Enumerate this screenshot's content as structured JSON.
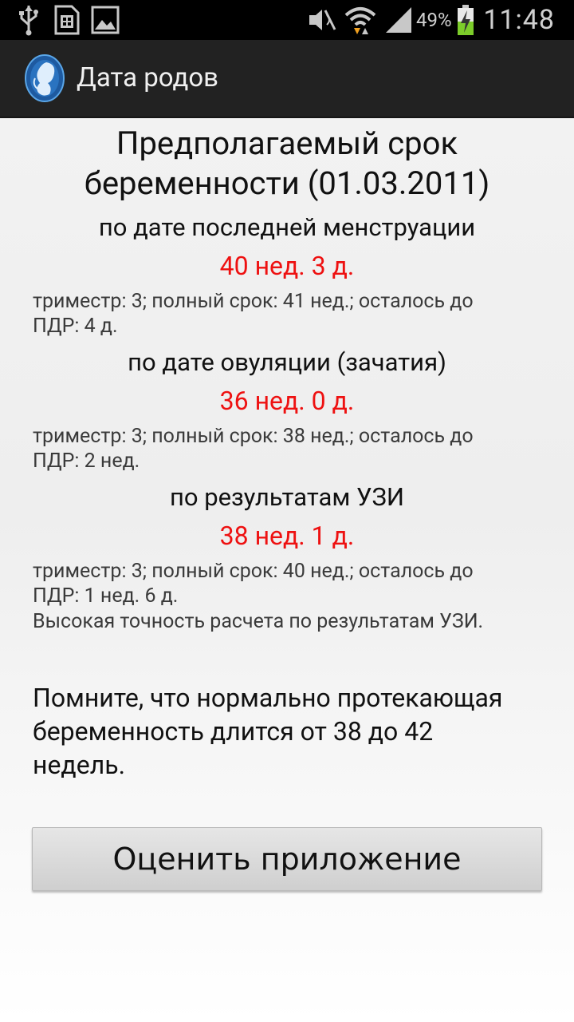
{
  "status_bar": {
    "battery_percent": "49%",
    "time": "11:48",
    "icons": [
      "usb-icon",
      "sim-card-icon",
      "image-icon",
      "mute-icon",
      "wifi-icon",
      "signal-icon",
      "battery-charging-icon"
    ]
  },
  "action_bar": {
    "title": "Дата родов",
    "logo": "fetus-logo-icon"
  },
  "main": {
    "heading_line1": "Предполагаемый срок",
    "heading_line2": "беременности (01.03.2011)",
    "sections": [
      {
        "subtitle": "по дате последней менструации",
        "result": "40 нед. 3 д.",
        "detail_line1": "триместр: 3; полный срок: 41 нед.; осталось до",
        "detail_line2": "ПДР: 4 д."
      },
      {
        "subtitle": "по дате овуляции (зачатия)",
        "result": "36 нед. 0 д.",
        "detail_line1": "триместр: 3; полный срок: 38 нед.; осталось до",
        "detail_line2": "ПДР: 2 нед."
      },
      {
        "subtitle": "по результатам УЗИ",
        "result": "38 нед. 1 д.",
        "detail_line1": "триместр: 3; полный срок: 40 нед.; осталось до",
        "detail_line2": "ПДР: 1 нед. 6 д.",
        "detail_line3": "Высокая точность расчета по результатам УЗИ."
      }
    ],
    "reminder_line1": "Помните, что нормально протекающая",
    "reminder_line2": "беременность длится от 38 до 42",
    "reminder_line3": "недель.",
    "rate_button_label": "Оценить приложение"
  },
  "colors": {
    "result_red": "#ee1111",
    "action_bar_bg": "#222222",
    "status_bar_bg": "#000000"
  }
}
